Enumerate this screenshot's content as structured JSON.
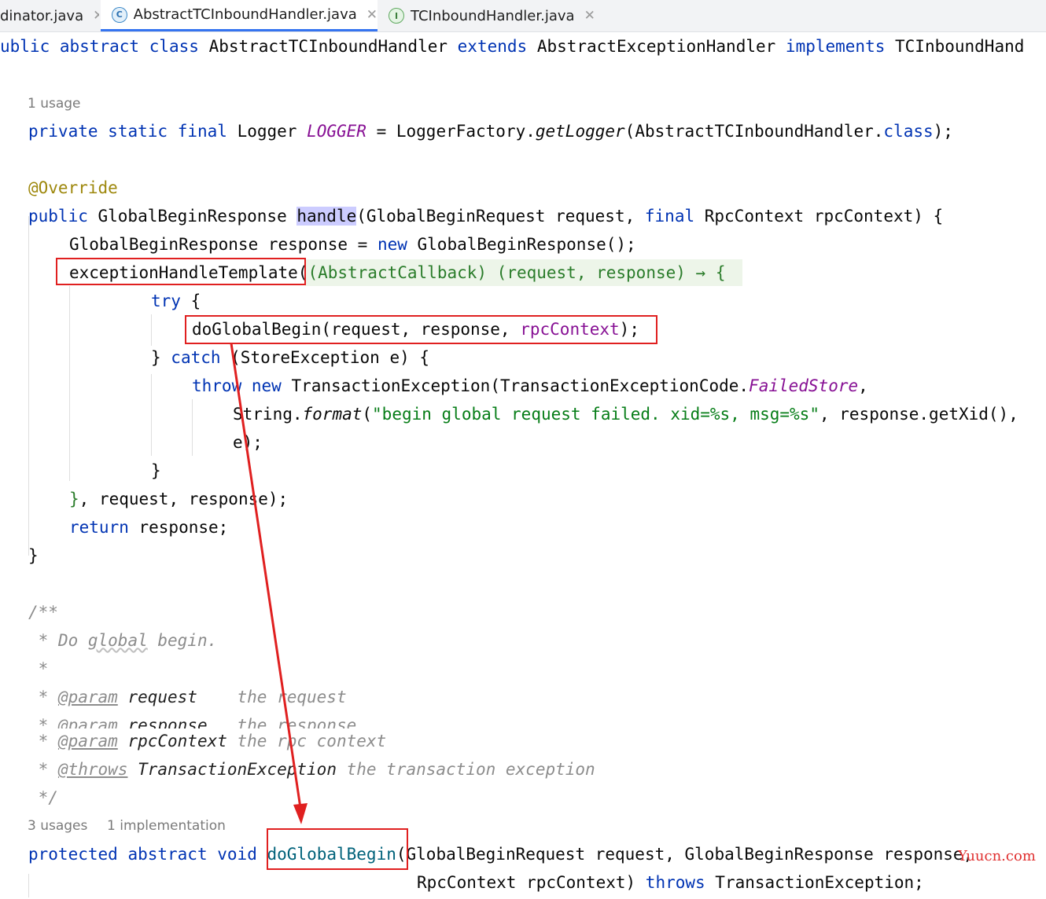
{
  "tabs": [
    {
      "label": "dinator.java",
      "icon": "none",
      "active": false,
      "close": "✕"
    },
    {
      "label": "AbstractTCInboundHandler.java",
      "icon": "class-icon",
      "icon_glyph": "C",
      "active": true,
      "close": "✕"
    },
    {
      "label": "TCInboundHandler.java",
      "icon": "interface-icon",
      "icon_glyph": "I",
      "active": false,
      "close": "✕"
    }
  ],
  "code": {
    "class_decl": {
      "kw1": "ublic",
      "kw2": "abstract",
      "kw3": "class",
      "name": "AbstractTCInboundHandler",
      "kw4": "extends",
      "parent": "AbstractExceptionHandler",
      "kw5": "implements",
      "iface": "TCInboundHand"
    },
    "hint_usage_1": "1 usage",
    "logger_line": {
      "kw1": "private",
      "kw2": "static",
      "kw3": "final",
      "type": "Logger",
      "field": "LOGGER",
      "mid": " = LoggerFactory.",
      "method": "getLogger",
      "arg": "(AbstractTCInboundHandler.",
      "kw4": "class",
      "end": ");"
    },
    "annotation": "@Override",
    "handle_sig": {
      "kw1": "public",
      "type": " GlobalBeginResponse ",
      "method": "handle",
      "p1": "(GlobalBeginRequest request, ",
      "kw2": "final",
      "p2": " RpcContext rpcContext) {"
    },
    "response_line": {
      "pre": "GlobalBeginResponse response = ",
      "kw": "new",
      "post": " GlobalBeginResponse();"
    },
    "template_line": {
      "method": "exceptionHandleTemplate",
      "paren": "(",
      "lambda": "(AbstractCallback) (request, response) → {"
    },
    "try_line": {
      "kw": "try",
      "post": " {"
    },
    "doglobal_call": {
      "pre": "doGlobalBegin(request, response, ",
      "param": "rpcContext",
      "post": ");"
    },
    "catch_line": {
      "pre": "} ",
      "kw": "catch",
      "post": " (StoreException e) {"
    },
    "throw_line": {
      "kw1": "throw",
      "kw2": "new",
      "mid": " TransactionException(TransactionExceptionCode.",
      "const": "FailedStore",
      "end": ","
    },
    "format_line": {
      "pre": "String.",
      "method": "format",
      "open": "(",
      "str": "\"begin global request failed. xid=%s, msg=%s\"",
      "post": ", response.getXid(),"
    },
    "e_line": "e);",
    "close_brace_inner": "}",
    "lambda_close": {
      "brace": "}",
      "post": ", request, response);"
    },
    "return_line": {
      "kw": "return",
      "post": " response;"
    },
    "class_close_brace": "}",
    "javadoc": {
      "open": "/**",
      "desc": {
        "star": " * ",
        "do": "Do ",
        "global": "global",
        "rest": " begin."
      },
      "blank": " *",
      "param1": {
        "star": " * ",
        "tag": "@param",
        "name": " request    ",
        "text": "the request"
      },
      "param2": {
        "star": " * ",
        "tag": "@param",
        "name": " response   ",
        "text": "the response"
      },
      "param3": {
        "star": " * ",
        "tag": "@param",
        "name": " rpcContext ",
        "text": "the rpc context"
      },
      "throws": {
        "star": " * ",
        "tag": "@throws",
        "name": " TransactionException ",
        "text": "the transaction exception"
      },
      "close": " */"
    },
    "hint_usage_3": "3 usages",
    "hint_impl": "1 implementation",
    "abstract_decl": {
      "kw1": "protected",
      "kw2": "abstract",
      "kw3": "void",
      "method": "doGlobalBegin",
      "params": "(GlobalBeginRequest request, GlobalBeginResponse response,"
    },
    "abstract_decl_2": {
      "pre": "RpcContext rpcContext) ",
      "kw": "throws",
      "post": " TransactionException;"
    }
  },
  "watermark": "Yuucn.com",
  "colors": {
    "keyword": "#0033b3",
    "annotation": "#9e880d",
    "static_field": "#871094",
    "string": "#067d17",
    "comment": "#8c8c8c",
    "highlight": "#ccccff",
    "lambda_bg": "#edf5e9",
    "callout_red": "#e02020"
  }
}
